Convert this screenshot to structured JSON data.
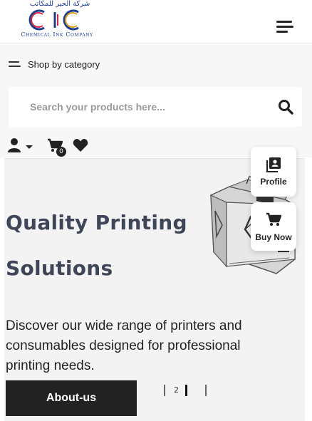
{
  "header": {
    "logo_arabic": "شركة الحبر للمكاتب",
    "logo_company": "Chemical Ink Company",
    "menu_icon": "hamburger-menu-icon"
  },
  "category": {
    "label": "Shop by category",
    "icon": "category-lines-icon"
  },
  "search": {
    "placeholder": "Search your products here...",
    "value": "",
    "icon": "search-icon"
  },
  "tools": {
    "account_icon": "user-icon",
    "cart_icon": "cart-icon",
    "cart_count": "0",
    "wishlist_icon": "heart-icon"
  },
  "hero": {
    "title_line1": "Quality Printing",
    "title_line2": "Solutions",
    "description": "Discover our wide range of printers and consumables designed for professional printing needs.",
    "cta_label": "About-us",
    "image": "printer-image"
  },
  "pager": {
    "current": "2"
  },
  "floating": {
    "profile_label": "Profile",
    "profile_icon": "profile-book-icon",
    "buy_label": "Buy Now",
    "buy_icon": "cart-icon"
  },
  "colors": {
    "title": "#3f4657",
    "button_bg": "#222222",
    "logo_blue": "#1f3f8f",
    "logo_red": "#d9263c"
  }
}
